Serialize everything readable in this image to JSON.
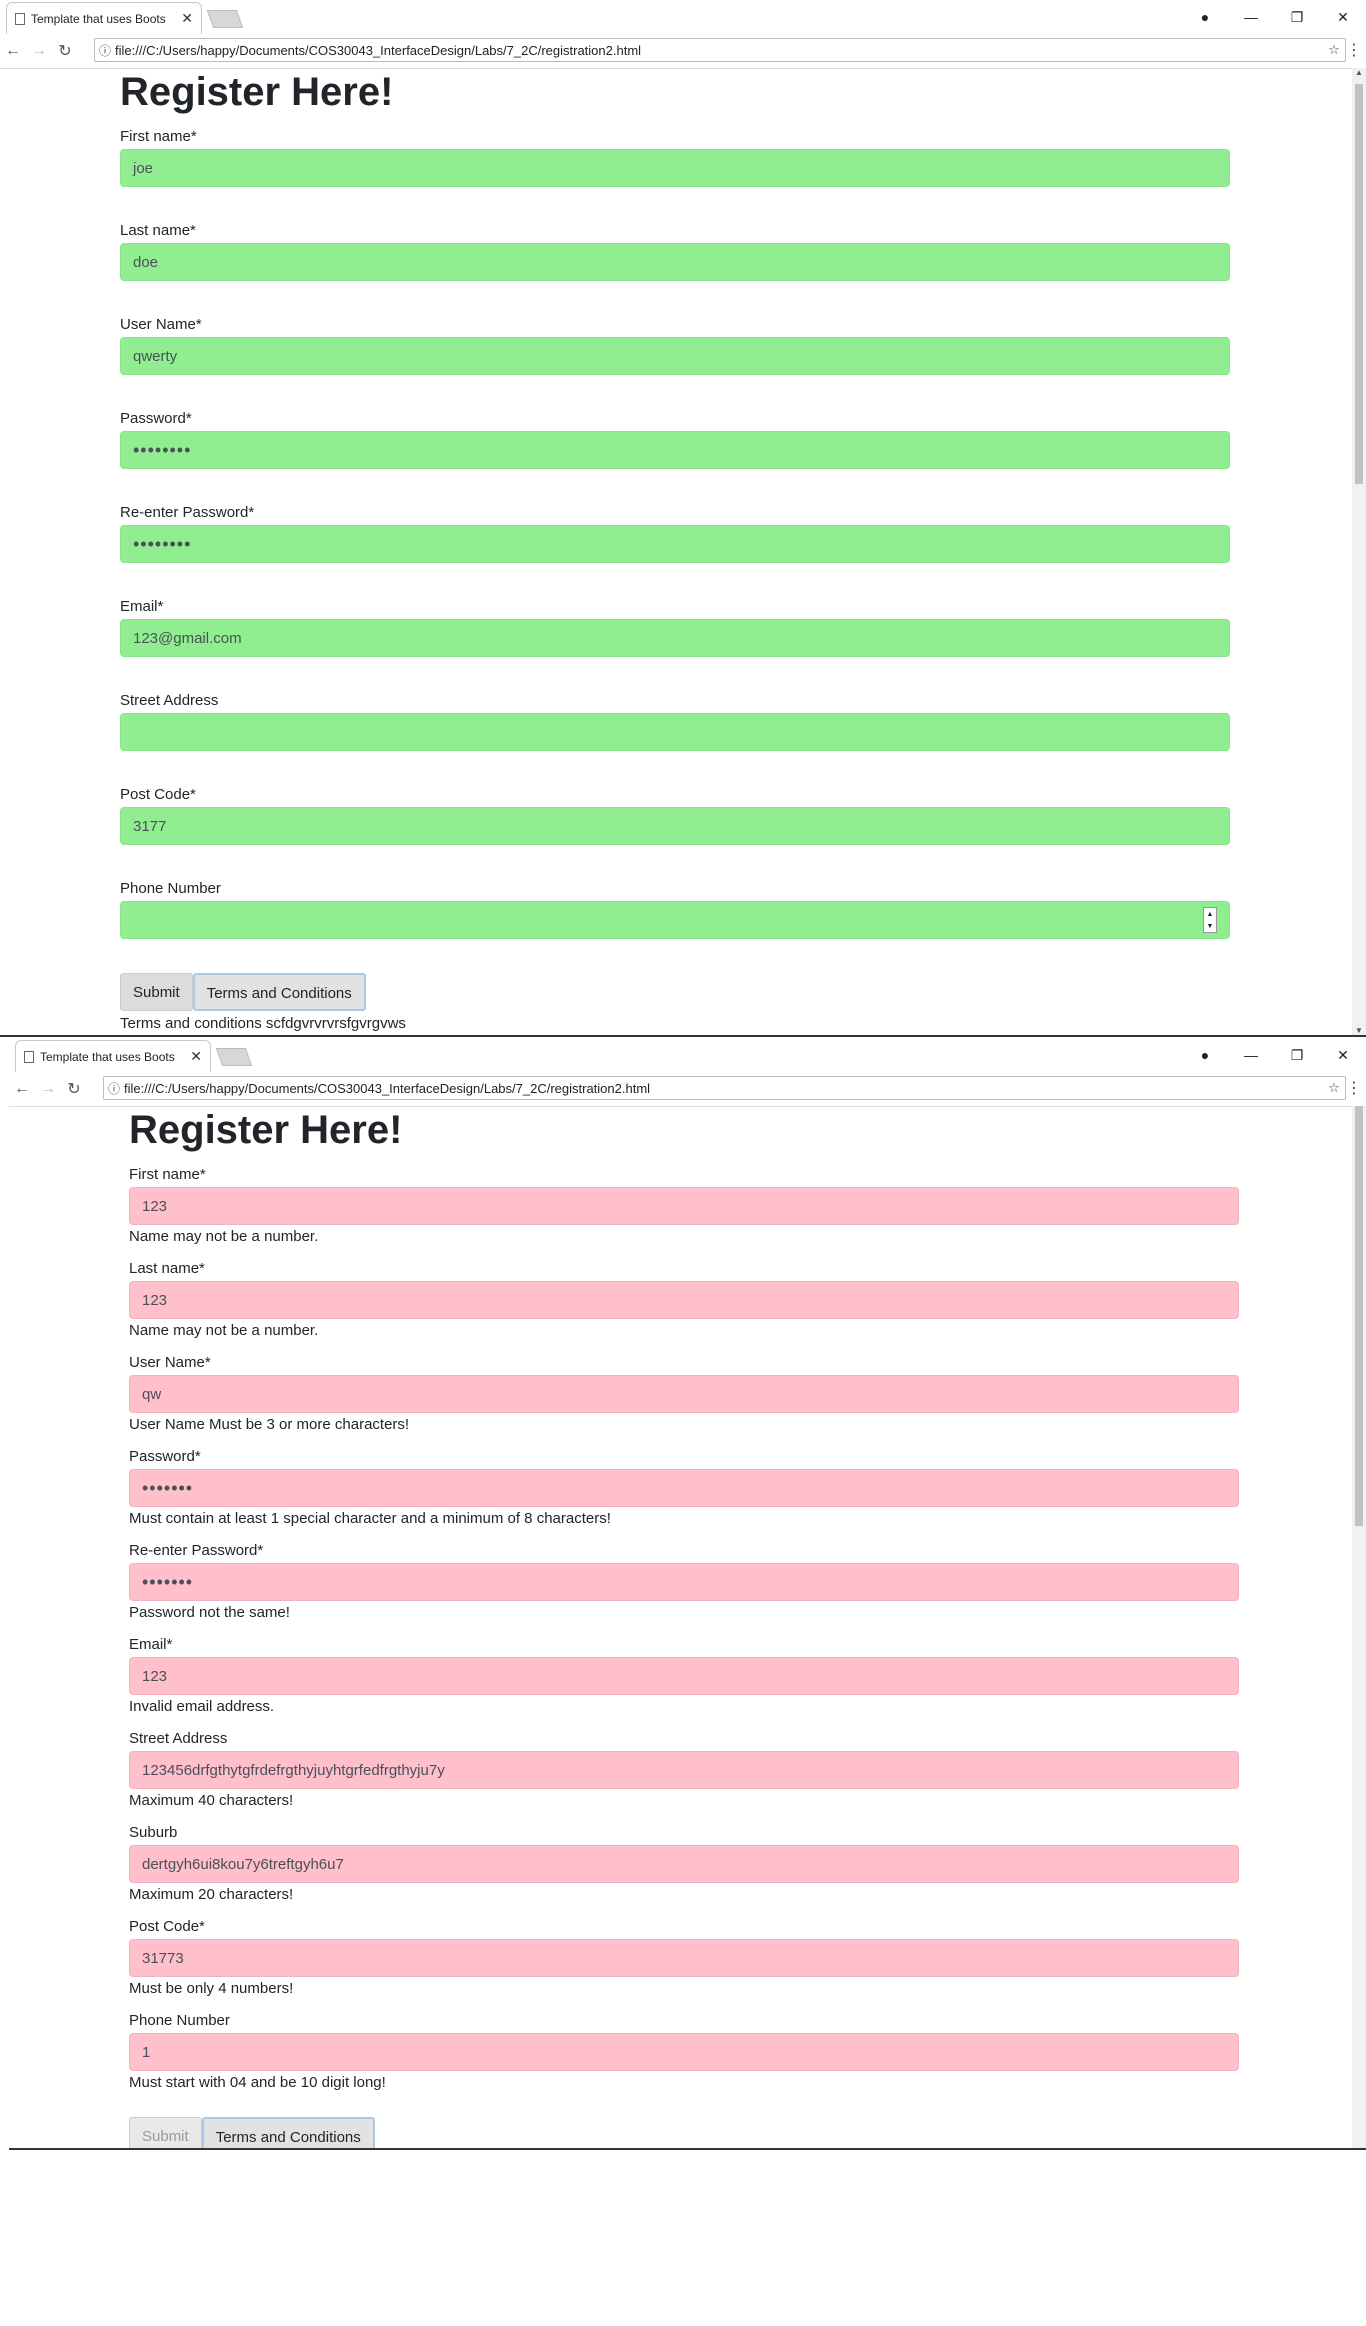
{
  "browser": {
    "tab_title": "Template that uses Boots",
    "url": "file:///C:/Users/happy/Documents/COS30043_InterfaceDesign/Labs/7_2C/registration2.html"
  },
  "valid_form": {
    "heading": "Register Here!",
    "fields": [
      {
        "label": "First name*",
        "value": "joe"
      },
      {
        "label": "Last name*",
        "value": "doe"
      },
      {
        "label": "User Name*",
        "value": "qwerty"
      },
      {
        "label": "Password*",
        "value": "••••••••"
      },
      {
        "label": "Re-enter Password*",
        "value": "••••••••"
      },
      {
        "label": "Email*",
        "value": "123@gmail.com"
      },
      {
        "label": "Street Address",
        "value": ""
      },
      {
        "label": "Post Code*",
        "value": "3177"
      },
      {
        "label": "Phone Number",
        "value": ""
      }
    ],
    "submit_label": "Submit",
    "terms_label": "Terms and Conditions",
    "terms_text": "Terms and conditions scfdgvrvrvrsfgvrgvws"
  },
  "invalid_form": {
    "heading": "Register Here!",
    "fields": [
      {
        "label": "First name*",
        "value": "123",
        "error": "Name may not be a number."
      },
      {
        "label": "Last name*",
        "value": "123",
        "error": "Name may not be a number."
      },
      {
        "label": "User Name*",
        "value": "qw",
        "error": "User Name Must be 3 or more characters!"
      },
      {
        "label": "Password*",
        "value": "•••••••",
        "error": "Must contain at least 1 special character and a minimum of 8 characters!"
      },
      {
        "label": "Re-enter Password*",
        "value": "•••••••",
        "error": "Password not the same!"
      },
      {
        "label": "Email*",
        "value": "123",
        "error": "Invalid email address."
      },
      {
        "label": "Street Address",
        "value": "123456drfgthytgfrdefrgthyjuyhtgrfedfrgthyju7y",
        "error": "Maximum 40 characters!"
      },
      {
        "label": "Suburb",
        "value": "dertgyh6ui8kou7y6treftgyh6u7",
        "error": "Maximum 20 characters!"
      },
      {
        "label": "Post Code*",
        "value": "31773",
        "error": "Must be only 4 numbers!"
      },
      {
        "label": "Phone Number",
        "value": "1",
        "error": "Must start with 04 and be 10 digit long!"
      }
    ],
    "submit_label": "Submit",
    "terms_label": "Terms and Conditions"
  },
  "icons": {
    "page": "page-icon",
    "close": "close-icon",
    "back": "back-arrow-icon",
    "forward": "forward-arrow-icon",
    "reload": "reload-icon",
    "info": "info-icon",
    "star": "star-icon",
    "menu": "menu-dots-icon",
    "account": "account-icon"
  },
  "colors": {
    "valid_field": "#90ee90",
    "invalid_field": "#ffc0cb",
    "button": "#dcdcdc"
  }
}
